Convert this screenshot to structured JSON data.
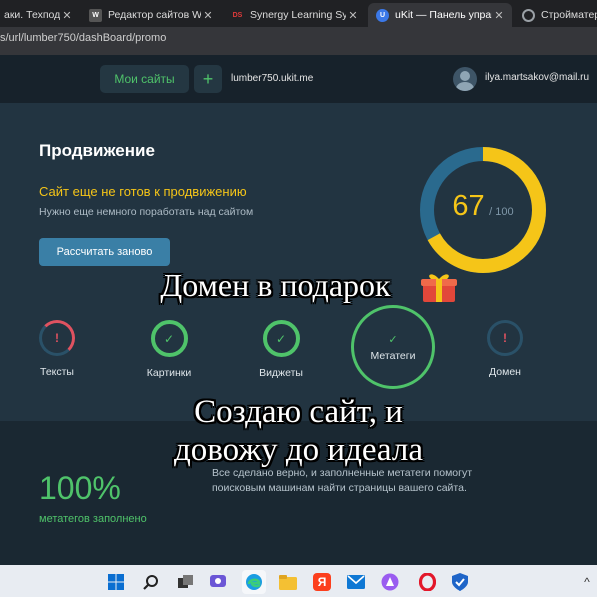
{
  "browser": {
    "tabs": [
      {
        "title": "аки. Техподде",
        "close": "✕",
        "active": false,
        "favicon": "none"
      },
      {
        "title": "Редактор сайтов Wix",
        "close": "✕",
        "active": false,
        "favicon": "wix"
      },
      {
        "title": "Synergy Learning Syste",
        "close": "✕",
        "active": false,
        "favicon": "synergy"
      },
      {
        "title": "uKit — Панель управ...",
        "close": "✕",
        "active": true,
        "favicon": "ukit"
      },
      {
        "title": "Стройматери",
        "close": "",
        "active": false,
        "favicon": "globe"
      }
    ],
    "url": "s/url/lumber750/dashBoard/promo"
  },
  "nav": {
    "my_sites": "Мои сайты",
    "plus": "+",
    "domain": "lumber750.ukit.me",
    "email": "ilya.martsakov@mail.ru"
  },
  "promo": {
    "title": "Продвижение",
    "warning": "Сайт еще не готов к продвижению",
    "hint": "Нужно еще немного поработать над сайтом",
    "recalc_button": "Рассчитать заново",
    "score": "67",
    "score_max": "/ 100",
    "score_fraction": 0.67,
    "checks": [
      {
        "label": "Тексты",
        "status": "error",
        "mark": "!"
      },
      {
        "label": "Картинки",
        "status": "ok",
        "mark": "✓"
      },
      {
        "label": "Виджеты",
        "status": "ok",
        "mark": "✓"
      },
      {
        "label": "Метатеги",
        "status": "ok",
        "mark": "✓",
        "selected": true
      },
      {
        "label": "Домен",
        "status": "error",
        "mark": "!"
      }
    ]
  },
  "detail": {
    "percent": "100%",
    "percent_label": "метатегов заполнено",
    "description": "Все сделано верно, и заполненные метатеги помогут поисковым машинам найти страницы вашего сайта."
  },
  "overlay": {
    "line1": "Домен в подарок",
    "line2a": "Создаю сайт, и",
    "line2b": "довожу до идеала"
  },
  "taskbar": {
    "icons": [
      "windows-icon",
      "search-icon",
      "task-view-icon",
      "chat-icon",
      "edge-icon",
      "file-explorer-icon",
      "yandex-icon",
      "mail-icon",
      "alice-icon",
      "opera-icon",
      "security-icon"
    ],
    "yandex_letter": "Я",
    "tray_chevron": "^"
  },
  "colors": {
    "accent_green": "#4fc36a",
    "accent_yellow": "#f5c518",
    "error_red": "#e05260",
    "gauge_track": "#2a6a8e",
    "button_blue": "#3a7fa6"
  }
}
